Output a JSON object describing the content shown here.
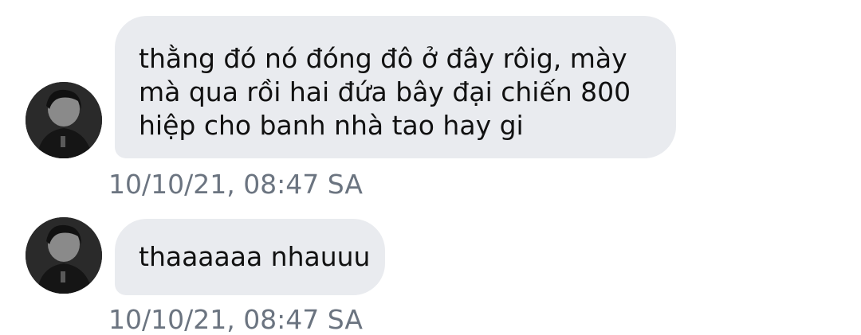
{
  "messages": [
    {
      "lines": [
        "thằng đó nó đóng đô ở đây rôig, mày",
        "mà qua rồi hai đứa bây đại chiến 800",
        "hiệp cho banh nhà tao hay gi"
      ],
      "timestamp": "10/10/21, 08:47 SA",
      "avatar_icon": "user-avatar-icon"
    },
    {
      "lines": [
        "thaaaaaa nhauuu"
      ],
      "timestamp": "10/10/21, 08:47 SA",
      "avatar_icon": "user-avatar-icon"
    }
  ],
  "colors": {
    "bubble_background": "#e9ebef",
    "text": "#111111",
    "timestamp": "#6b7480",
    "background": "#ffffff"
  }
}
